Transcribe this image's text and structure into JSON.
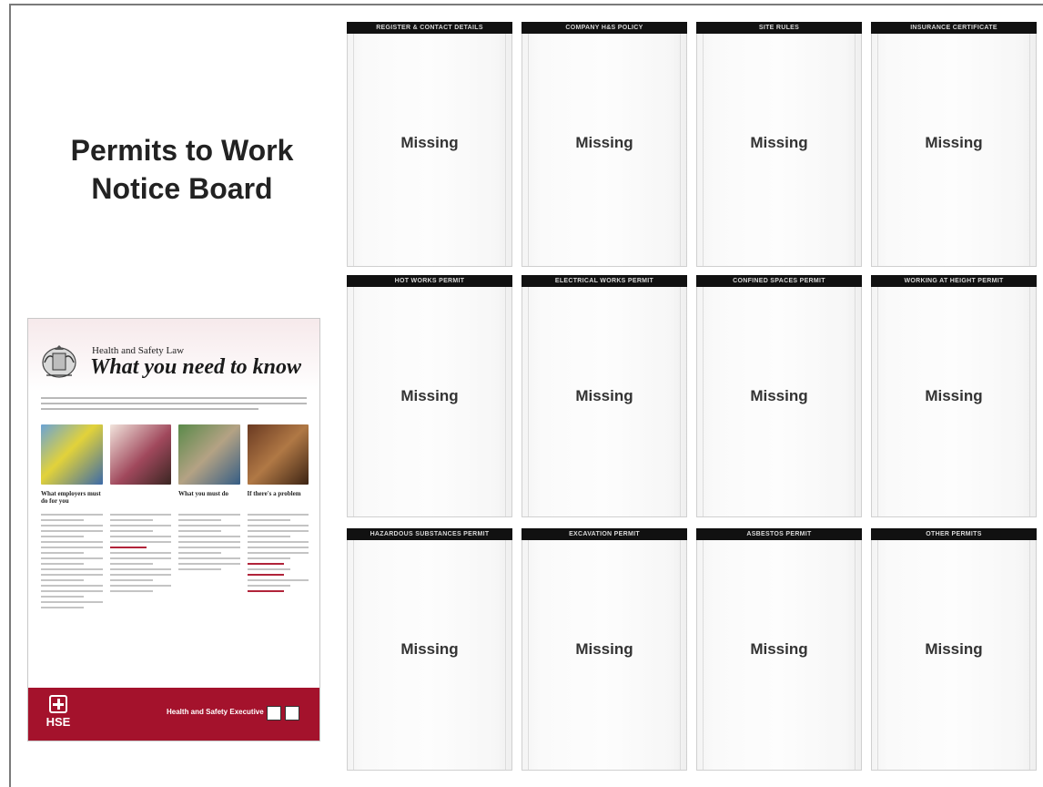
{
  "board": {
    "title_line1": "Permits to Work",
    "title_line2": "Notice Board"
  },
  "slots": [
    {
      "label": "REGISTER & CONTACT DETAILS",
      "status": "Missing"
    },
    {
      "label": "COMPANY H&S POLICY",
      "status": "Missing"
    },
    {
      "label": "SITE RULES",
      "status": "Missing"
    },
    {
      "label": "INSURANCE CERTIFICATE",
      "status": "Missing"
    },
    {
      "label": "HOT WORKS PERMIT",
      "status": "Missing"
    },
    {
      "label": "ELECTRICAL WORKS PERMIT",
      "status": "Missing"
    },
    {
      "label": "CONFINED SPACES PERMIT",
      "status": "Missing"
    },
    {
      "label": "WORKING AT HEIGHT PERMIT",
      "status": "Missing"
    },
    {
      "label": "HAZARDOUS SUBSTANCES PERMIT",
      "status": "Missing"
    },
    {
      "label": "EXCAVATION PERMIT",
      "status": "Missing"
    },
    {
      "label": "ASBESTOS PERMIT",
      "status": "Missing"
    },
    {
      "label": "OTHER PERMITS",
      "status": "Missing"
    }
  ],
  "poster": {
    "subtitle": "Health and Safety Law",
    "heading": "What you need to know",
    "col1_head": "What employers must do for you",
    "col2_head": "",
    "col3_head": "What you must do",
    "col4_head": "If there's a problem",
    "logo_text": "HSE",
    "org_name": "Health and Safety Executive"
  }
}
